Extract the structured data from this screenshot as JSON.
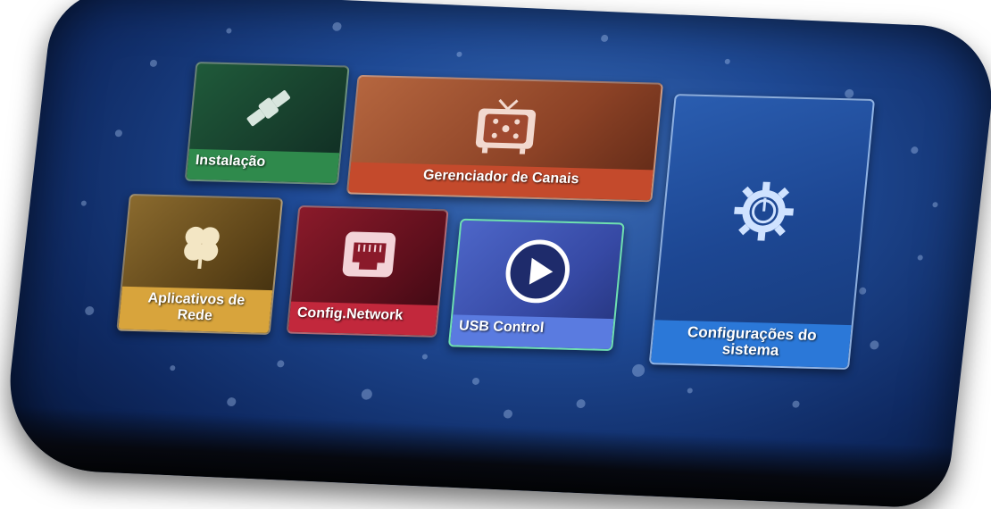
{
  "menu": {
    "tiles": [
      {
        "id": "installation",
        "label": "Instalação",
        "icon": "satellite-icon",
        "color": "#2f8a4c"
      },
      {
        "id": "channel-manager",
        "label": "Gerenciador de Canais",
        "icon": "tv-icon",
        "color": "#c44a2c"
      },
      {
        "id": "system-settings",
        "label": "Configurações do sistema",
        "icon": "gear-icon",
        "color": "#2b78d8"
      },
      {
        "id": "network-apps",
        "label": "Aplicativos de Rede",
        "icon": "clover-icon",
        "color": "#d8a43c"
      },
      {
        "id": "config-network",
        "label": "Config.Network",
        "icon": "ethernet-port-icon",
        "color": "#c2283c"
      },
      {
        "id": "usb-control",
        "label": "USB Control",
        "icon": "play-icon",
        "color": "#5a7be0",
        "selected": true
      }
    ]
  }
}
